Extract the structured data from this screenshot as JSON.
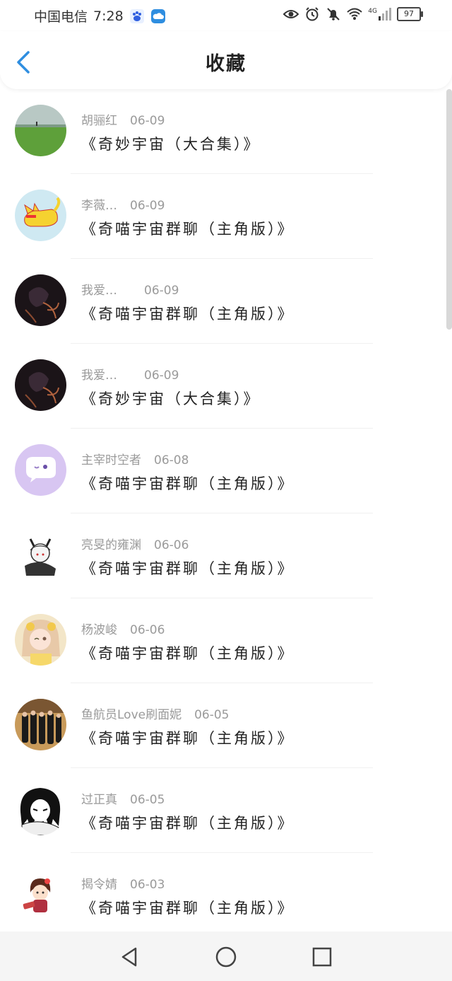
{
  "status_bar": {
    "carrier": "中国电信",
    "time": "7:28",
    "network": "4G",
    "battery": "97"
  },
  "header": {
    "title": "收藏"
  },
  "favorites": [
    {
      "user": "胡骊红",
      "date": "06-09",
      "content": "《奇妙宇宙（大合集）》",
      "avatar": "landscape-avatar"
    },
    {
      "user": "李薇…",
      "date": "06-09",
      "content": "《奇喵宇宙群聊（主角版）》",
      "avatar": "cat-avatar"
    },
    {
      "user": "我爱…",
      "date": "06-09",
      "content": "《奇喵宇宙群聊（主角版）》",
      "avatar": "dark-art-avatar"
    },
    {
      "user": "我爱…",
      "date": "06-09",
      "content": "《奇妙宇宙（大合集）》",
      "avatar": "dark-art-avatar"
    },
    {
      "user": "主宰时空者",
      "date": "06-08",
      "content": "《奇喵宇宙群聊（主角版）》",
      "avatar": "chat-bubble-avatar"
    },
    {
      "user": "亮旻的雍渊",
      "date": "06-06",
      "content": "《奇喵宇宙群聊（主角版）》",
      "avatar": "anime-avatar"
    },
    {
      "user": "杨波峻",
      "date": "06-06",
      "content": "《奇喵宇宙群聊（主角版）》",
      "avatar": "girl-avatar"
    },
    {
      "user": "鱼航员Love刷面妮",
      "date": "06-05",
      "content": "《奇喵宇宙群聊（主角版）》",
      "avatar": "group-photo-avatar"
    },
    {
      "user": "过正真",
      "date": "06-05",
      "content": "《奇喵宇宙群聊（主角版）》",
      "avatar": "manga-avatar"
    },
    {
      "user": "揭令婧",
      "date": "06-03",
      "content": "《奇喵宇宙群聊（主角版）》",
      "avatar": "chibi-avatar"
    }
  ],
  "colors": {
    "accent": "#2f8ee0",
    "meta_text": "#9a9a9a",
    "divider": "#f0f0f0"
  }
}
